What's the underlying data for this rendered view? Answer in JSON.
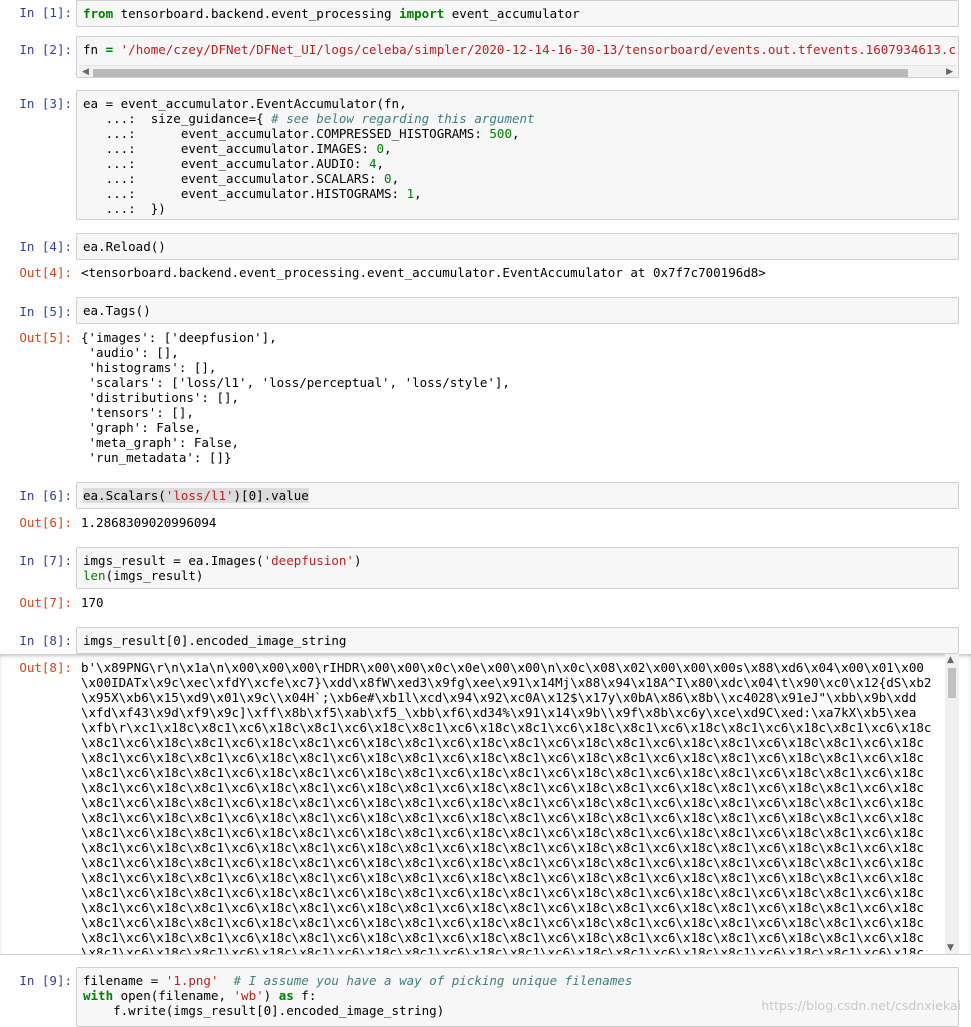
{
  "cells": {
    "c1": {
      "prompt": "In [1]:",
      "kw_from": "from",
      "module": " tensorboard.backend.event_processing ",
      "kw_import": "import",
      "name": " event_accumulator"
    },
    "c2": {
      "prompt": "In [2]:",
      "lhs": "fn ",
      "eq": "=",
      "str": "'/home/czey/DFNet/DFNet_UI/logs/celeba/simpler/2020-12-14-16-30-13/tensorboard/events.out.tfevents.1607934613.c"
    },
    "c3": {
      "prompt": "In [3]:",
      "line1": "ea = event_accumulator.EventAccumulator(fn,",
      "line2_a": "   ...:  size_guidance={ ",
      "line2_comment": "# see below regarding this argument",
      "lines": [
        {
          "pre": "   ...:      event_accumulator.COMPRESSED_HISTOGRAMS: ",
          "num": "500",
          "post": ","
        },
        {
          "pre": "   ...:      event_accumulator.IMAGES: ",
          "num": "0",
          "post": ","
        },
        {
          "pre": "   ...:      event_accumulator.AUDIO: ",
          "num": "4",
          "post": ","
        },
        {
          "pre": "   ...:      event_accumulator.SCALARS: ",
          "num": "0",
          "post": ","
        },
        {
          "pre": "   ...:      event_accumulator.HISTOGRAMS: ",
          "num": "1",
          "post": ","
        }
      ],
      "last": "   ...:  })"
    },
    "c4": {
      "prompt": "In [4]:",
      "code": "ea.Reload()",
      "out_prompt": "Out[4]:",
      "output": "<tensorboard.backend.event_processing.event_accumulator.EventAccumulator at 0x7f7c700196d8>"
    },
    "c5": {
      "prompt": "In [5]:",
      "code": "ea.Tags()",
      "out_prompt": "Out[5]:",
      "output": "{'images': ['deepfusion'],\n 'audio': [],\n 'histograms': [],\n 'scalars': ['loss/l1', 'loss/perceptual', 'loss/style'],\n 'distributions': [],\n 'tensors': [],\n 'graph': False,\n 'meta_graph': False,\n 'run_metadata': []}"
    },
    "c6": {
      "prompt": "In [6]:",
      "code_a": "ea.Scalars(",
      "code_str": "'loss/l1'",
      "code_b": ")[0].value",
      "out_prompt": "Out[6]:",
      "output": "1.2868309020996094"
    },
    "c7": {
      "prompt": "In [7]:",
      "line1_a": "imgs_result = ea.Images(",
      "line1_str": "'deepfusion'",
      "line1_b": ")",
      "line2_a": "len",
      "line2_b": "(imgs_result)",
      "out_prompt": "Out[7]:",
      "output": "170"
    },
    "c8": {
      "prompt": "In [8]:",
      "code": "imgs_result[0].encoded_image_string",
      "out_prompt": "Out[8]:",
      "output_lines": [
        "b'\\x89PNG\\r\\n\\x1a\\n\\x00\\x00\\x00\\rIHDR\\x00\\x00\\x0c\\x0e\\x00\\x00\\n\\x0c\\x08\\x02\\x00\\x00\\x00s\\x88\\xd6\\x04\\x00\\x01\\x00",
        "\\x00IDATx\\x9c\\xec\\xfdY\\xcfe\\xc7}\\xdd\\x8fW\\xed3\\x9fg\\xee\\x91\\x14Mj\\x88\\x94\\x18A^I\\x80\\xdc\\x04\\t\\x90\\xc0\\x12{dS\\xb2",
        "\\x95X\\xb6\\x15\\xd9\\x01\\x9c\\\\x04H`;\\xb6e#\\xb1l\\xcd\\x94\\x92\\xc0A\\x12$\\x17y\\x0bA\\x86\\x8b\\\\xc4028\\x91eJ\"\\xbb\\x9b\\xdd",
        "\\xfd\\xf43\\x9d\\xf9\\x9c]\\xff\\x8b\\xf5\\xab\\xf5_\\xbb\\xf6\\xd34%\\x91\\x14\\x9b\\\\x9f\\x8b\\xc6y\\xce\\xd9C\\xed:\\xa7kX\\xb5\\xea",
        "\\xfb\\r\\xc1\\x18c\\x8c1\\xc6\\x18c\\x8c1\\xc6\\x18c\\x8c1\\xc6\\x18c\\x8c1\\xc6\\x18c\\x8c1\\xc6\\x18c\\x8c1\\xc6\\x18c\\x8c1\\xc6\\x18c",
        "\\x8c1\\xc6\\x18c\\x8c1\\xc6\\x18c\\x8c1\\xc6\\x18c\\x8c1\\xc6\\x18c\\x8c1\\xc6\\x18c\\x8c1\\xc6\\x18c\\x8c1\\xc6\\x18c\\x8c1\\xc6\\x18c",
        "\\x8c1\\xc6\\x18c\\x8c1\\xc6\\x18c\\x8c1\\xc6\\x18c\\x8c1\\xc6\\x18c\\x8c1\\xc6\\x18c\\x8c1\\xc6\\x18c\\x8c1\\xc6\\x18c\\x8c1\\xc6\\x18c",
        "\\x8c1\\xc6\\x18c\\x8c1\\xc6\\x18c\\x8c1\\xc6\\x18c\\x8c1\\xc6\\x18c\\x8c1\\xc6\\x18c\\x8c1\\xc6\\x18c\\x8c1\\xc6\\x18c\\x8c1\\xc6\\x18c",
        "\\x8c1\\xc6\\x18c\\x8c1\\xc6\\x18c\\x8c1\\xc6\\x18c\\x8c1\\xc6\\x18c\\x8c1\\xc6\\x18c\\x8c1\\xc6\\x18c\\x8c1\\xc6\\x18c\\x8c1\\xc6\\x18c",
        "\\x8c1\\xc6\\x18c\\x8c1\\xc6\\x18c\\x8c1\\xc6\\x18c\\x8c1\\xc6\\x18c\\x8c1\\xc6\\x18c\\x8c1\\xc6\\x18c\\x8c1\\xc6\\x18c\\x8c1\\xc6\\x18c",
        "\\x8c1\\xc6\\x18c\\x8c1\\xc6\\x18c\\x8c1\\xc6\\x18c\\x8c1\\xc6\\x18c\\x8c1\\xc6\\x18c\\x8c1\\xc6\\x18c\\x8c1\\xc6\\x18c\\x8c1\\xc6\\x18c",
        "\\x8c1\\xc6\\x18c\\x8c1\\xc6\\x18c\\x8c1\\xc6\\x18c\\x8c1\\xc6\\x18c\\x8c1\\xc6\\x18c\\x8c1\\xc6\\x18c\\x8c1\\xc6\\x18c\\x8c1\\xc6\\x18c",
        "\\x8c1\\xc6\\x18c\\x8c1\\xc6\\x18c\\x8c1\\xc6\\x18c\\x8c1\\xc6\\x18c\\x8c1\\xc6\\x18c\\x8c1\\xc6\\x18c\\x8c1\\xc6\\x18c\\x8c1\\xc6\\x18c",
        "\\x8c1\\xc6\\x18c\\x8c1\\xc6\\x18c\\x8c1\\xc6\\x18c\\x8c1\\xc6\\x18c\\x8c1\\xc6\\x18c\\x8c1\\xc6\\x18c\\x8c1\\xc6\\x18c\\x8c1\\xc6\\x18c",
        "\\x8c1\\xc6\\x18c\\x8c1\\xc6\\x18c\\x8c1\\xc6\\x18c\\x8c1\\xc6\\x18c\\x8c1\\xc6\\x18c\\x8c1\\xc6\\x18c\\x8c1\\xc6\\x18c\\x8c1\\xc6\\x18c",
        "\\x8c1\\xc6\\x18c\\x8c1\\xc6\\x18c\\x8c1\\xc6\\x18c\\x8c1\\xc6\\x18c\\x8c1\\xc6\\x18c\\x8c1\\xc6\\x18c\\x8c1\\xc6\\x18c\\x8c1\\xc6\\x18c",
        "\\x8c1\\xc6\\x18c\\x8c1\\xc6\\x18c\\x8c1\\xc6\\x18c\\x8c1\\xc6\\x18c\\x8c1\\xc6\\x18c\\x8c1\\xc6\\x18c\\x8c1\\xc6\\x18c\\x8c1\\xc6\\x18c",
        "\\x8c1\\xc6\\x18c\\x8c1\\xc6\\x18c\\x8c1\\xc6\\x18c\\x8c1\\xc6\\x18c\\x8c1\\xc6\\x18c\\x8c1\\xc6\\x18c\\x8c1\\xc6\\x18c\\x8c1\\xc6\\x18c",
        "\\x8c1\\xc6\\x18c\\x8c1\\xc6\\x18c\\x8c1\\xc6\\x18c\\x8c1\\xc6\\x18c\\x8c1\\xc6\\x18c\\x8c1\\xc6\\x18c\\x8c1\\xc6\\x18c\\x8c1\\xc6\\x18c",
        "\\x8c1\\xc6\\x18c\\x8c1\\xc6\\x18c\\x8c1\\xc6\\x18c\\x8c1\\xc6\\x18c\\x8c1\\xc6\\x18c\\x8c1\\xc6\\x18c\\x8c1\\xc6\\x18c\\x8c1\\xc6\\x18c"
      ]
    },
    "c9": {
      "prompt": "In [9]:",
      "line1_a": "filename = ",
      "line1_str": "'1.png'",
      "line1_com": "  # I assume you have a way of picking unique filenames",
      "line2_kw": "with",
      "line2_a": " open(filename, ",
      "line2_str": "'wb'",
      "line2_b": ") ",
      "line2_kw2": "as",
      "line2_c": " f:",
      "line3": "    f.write(imgs_result[0].encoded_image_string)"
    }
  },
  "watermark": "https://blog.csdn.net/csdnxiekai"
}
